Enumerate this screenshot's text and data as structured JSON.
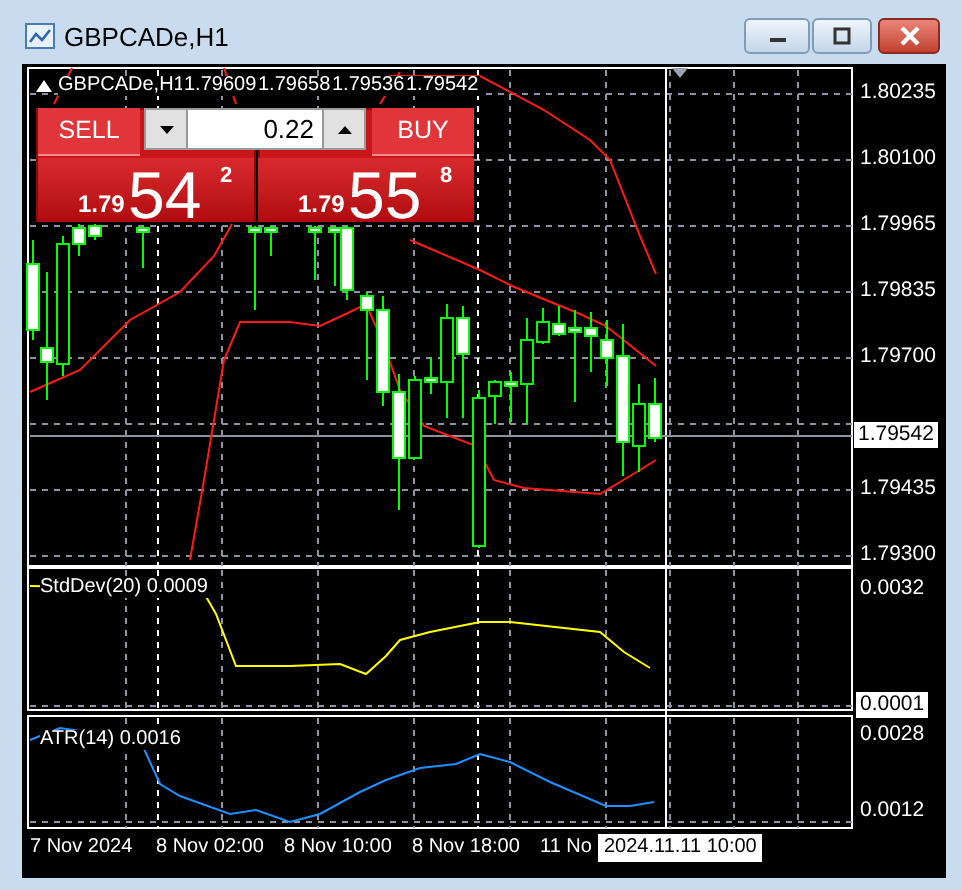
{
  "window": {
    "title": "GBPCADe,H1"
  },
  "chart_header": {
    "symbol": "GBPCADe,H1",
    "open": "1.79609",
    "high": "1.79658",
    "low": "1.79536",
    "close": "1.79542"
  },
  "trade_panel": {
    "sell_label": "SELL",
    "buy_label": "BUY",
    "volume": "0.22",
    "sell_price": {
      "prefix": "1.79",
      "big": "54",
      "small": "2"
    },
    "buy_price": {
      "prefix": "1.79",
      "big": "55",
      "small": "8"
    }
  },
  "price_axis": [
    "1.80235",
    "1.80100",
    "1.79965",
    "1.79835",
    "1.79700",
    "1.79435",
    "1.79300"
  ],
  "current_price": "1.79542",
  "indicators": [
    {
      "label": "StdDev(20) 0.0009",
      "color": "#ffff00",
      "axis": [
        "0.0032"
      ],
      "axis_current": "0.0001"
    },
    {
      "label": "ATR(14) 0.0016",
      "color": "#1e90ff",
      "axis": [
        "0.0028",
        "0.0012"
      ]
    }
  ],
  "time_axis": [
    "7 Nov 2024",
    "8 Nov 02:00",
    "8 Nov 10:00",
    "8 Nov 18:00",
    "11 No"
  ],
  "crosshair_time": "2024.11.11 10:00"
}
